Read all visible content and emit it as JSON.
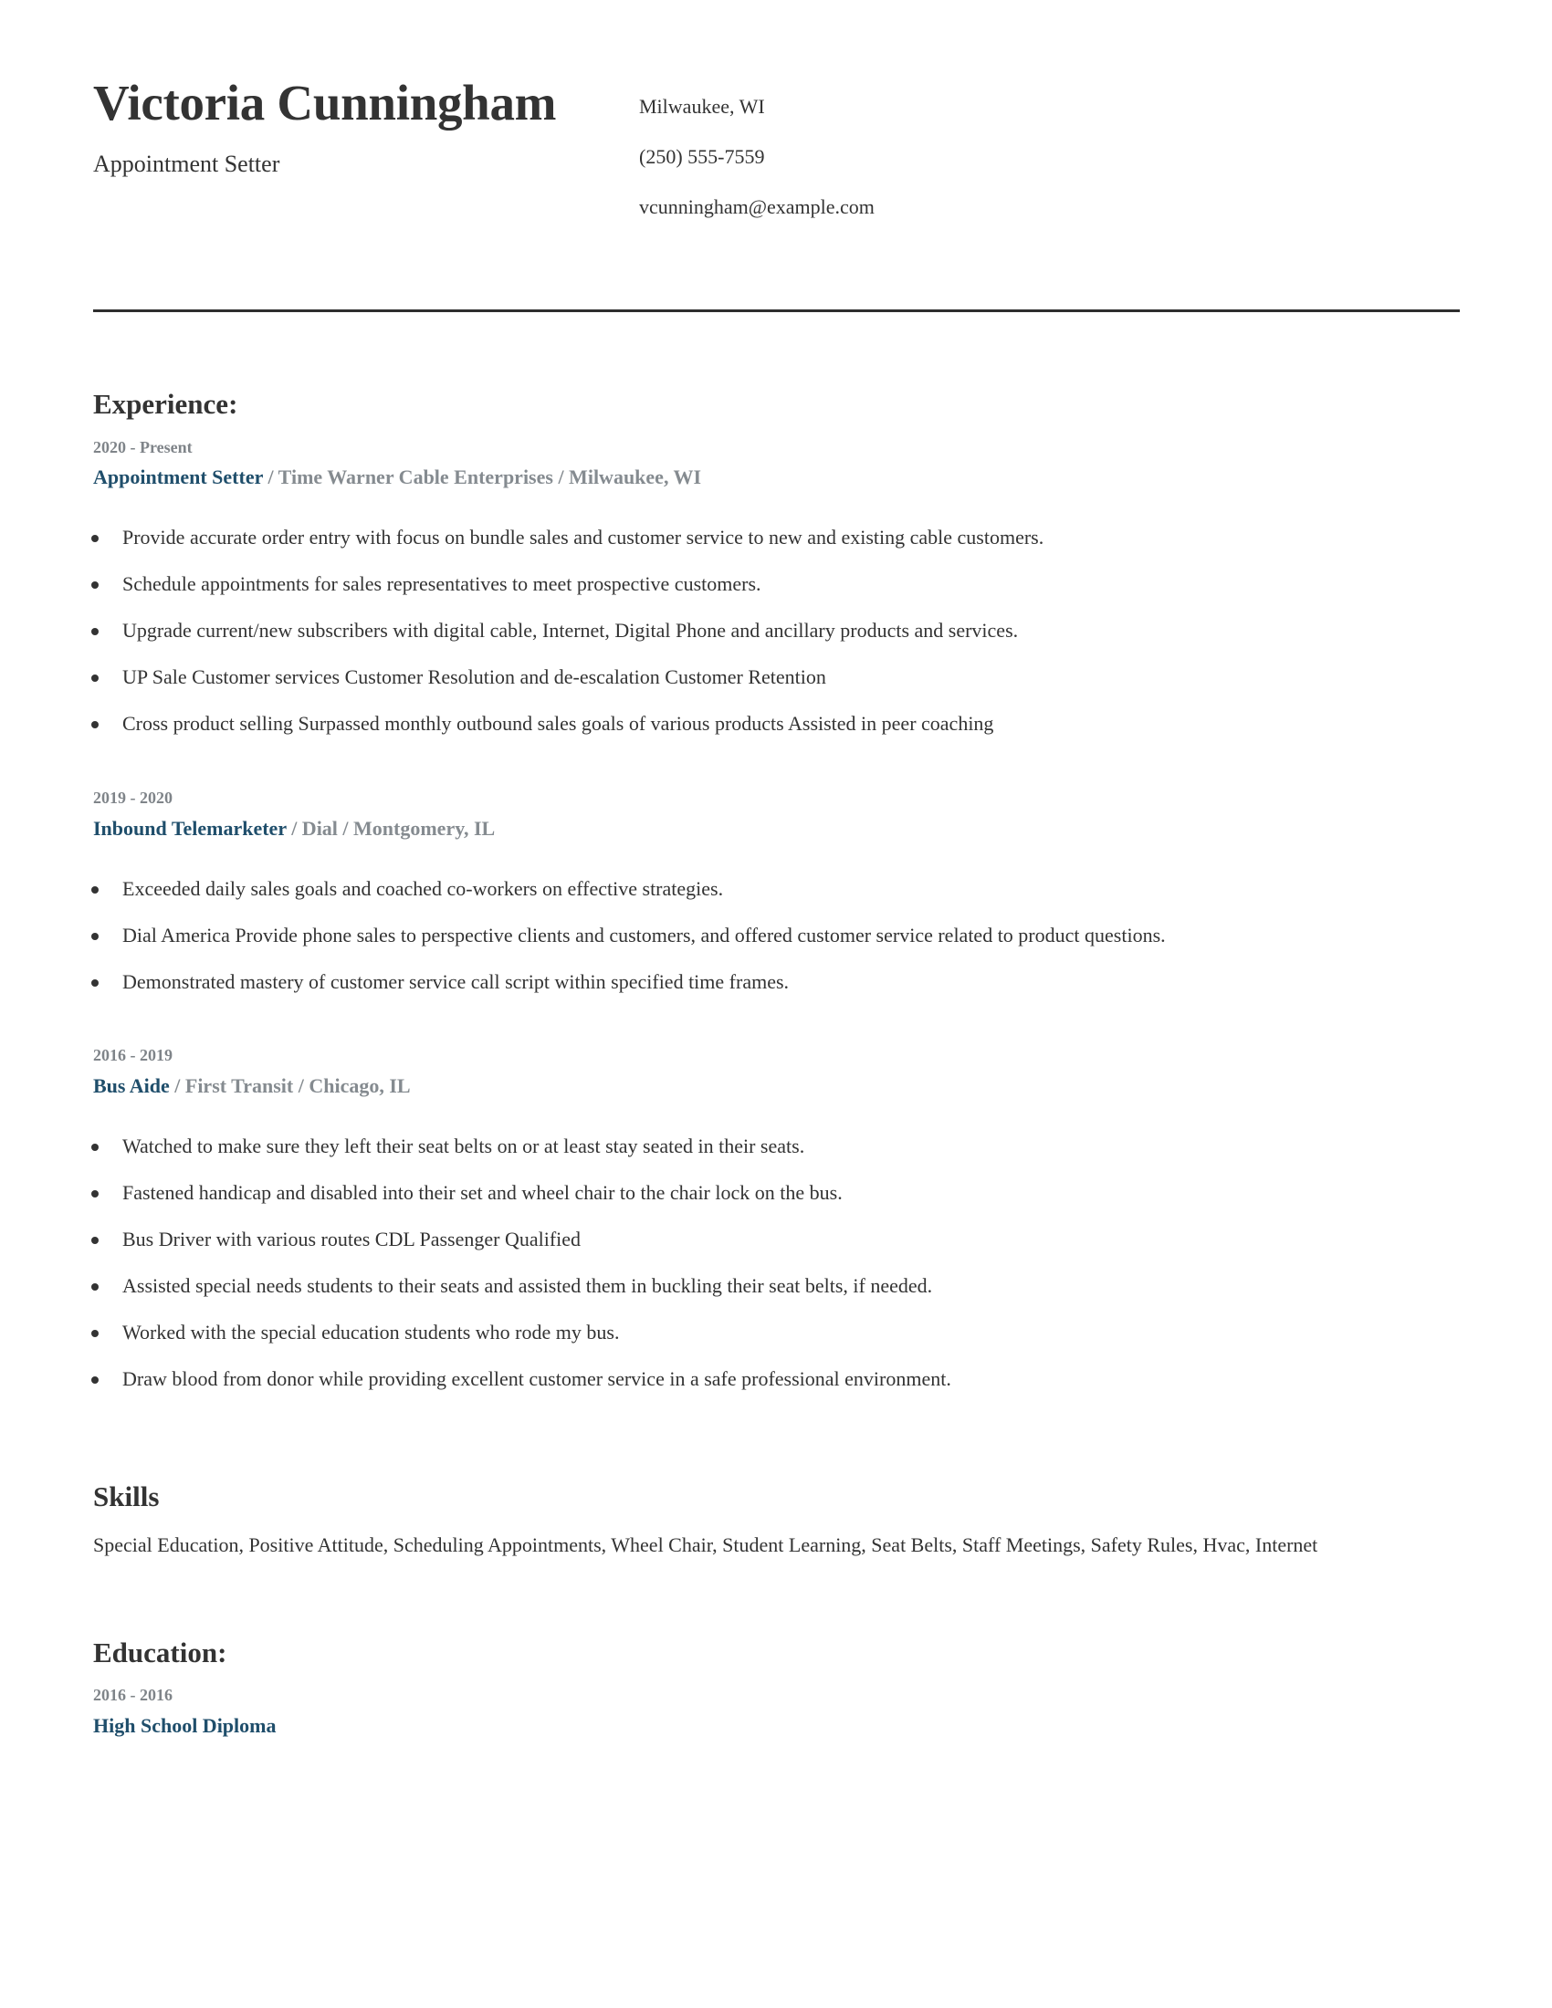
{
  "header": {
    "name": "Victoria Cunningham",
    "title": "Appointment Setter",
    "contact": {
      "location": "Milwaukee, WI",
      "phone": "(250) 555-7559",
      "email": "vcunningham@example.com"
    }
  },
  "experience": {
    "heading": "Experience:",
    "jobs": [
      {
        "dates": "2020 - Present",
        "title": "Appointment Setter",
        "meta": " / Time Warner Cable Enterprises / Milwaukee, WI",
        "bullets": [
          "Provide accurate order entry with focus on bundle sales and customer service to new and existing cable customers.",
          "Schedule appointments for sales representatives to meet prospective customers.",
          "Upgrade current/new subscribers with digital cable, Internet, Digital Phone and ancillary products and services.",
          "UP Sale Customer services Customer Resolution and de-escalation Customer Retention",
          "Cross product selling Surpassed monthly outbound sales goals of various products Assisted in peer coaching"
        ]
      },
      {
        "dates": "2019 - 2020",
        "title": "Inbound Telemarketer",
        "meta": " / Dial / Montgomery, IL",
        "bullets": [
          "Exceeded daily sales goals and coached co-workers on effective strategies.",
          "Dial America Provide phone sales to perspective clients and customers, and offered customer service related to product questions.",
          "Demonstrated mastery of customer service call script within specified time frames."
        ]
      },
      {
        "dates": "2016 - 2019",
        "title": "Bus Aide",
        "meta": " / First Transit / Chicago, IL",
        "bullets": [
          "Watched to make sure they left their seat belts on or at least stay seated in their seats.",
          "Fastened handicap and disabled into their set and wheel chair to the chair lock on the bus.",
          "Bus Driver with various routes CDL Passenger Qualified",
          "Assisted special needs students to their seats and assisted them in buckling their seat belts, if needed.",
          "Worked with the special education students who rode my bus.",
          "Draw blood from donor while providing excellent customer service in a safe professional environment."
        ]
      }
    ]
  },
  "skills": {
    "heading": "Skills",
    "text": "Special Education, Positive Attitude, Scheduling Appointments, Wheel Chair, Student Learning, Seat Belts, Staff Meetings, Safety Rules, Hvac, Internet"
  },
  "education": {
    "heading": "Education:",
    "entries": [
      {
        "dates": "2016 - 2016",
        "title": "High School Diploma"
      }
    ]
  },
  "colors": {
    "text": "#333333",
    "accent": "#1f4e6b",
    "muted": "#7f8489"
  }
}
